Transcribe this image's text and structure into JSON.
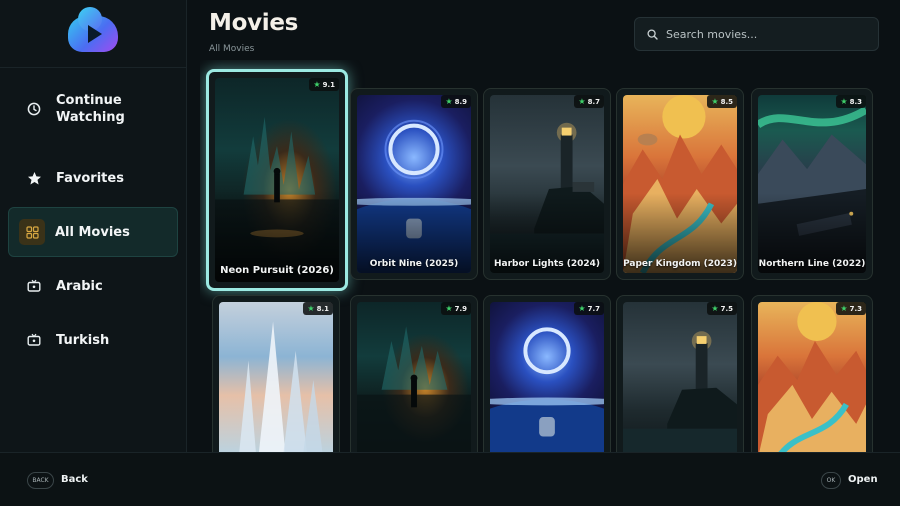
{
  "sidebar": {
    "items": [
      {
        "label": "Continue Watching",
        "icon": "clock-icon",
        "active": false
      },
      {
        "label": "Favorites",
        "icon": "star-icon",
        "active": false
      },
      {
        "label": "All Movies",
        "icon": "grid-icon",
        "active": true
      },
      {
        "label": "Arabic",
        "icon": "tv-icon",
        "active": false
      },
      {
        "label": "Turkish",
        "icon": "tv-icon",
        "active": false
      }
    ]
  },
  "header": {
    "title": "Movies",
    "breadcrumb": "All Movies",
    "search_placeholder": "Search movies..."
  },
  "movies": [
    {
      "title": "Neon Pursuit (2026)",
      "rating": "9.1",
      "art": "neon",
      "focused": true
    },
    {
      "title": "Orbit Nine (2025)",
      "rating": "8.9",
      "art": "orbit",
      "focused": false
    },
    {
      "title": "Harbor Lights (2024)",
      "rating": "8.7",
      "art": "harbor",
      "focused": false
    },
    {
      "title": "Paper Kingdom (2023)",
      "rating": "8.5",
      "art": "paper",
      "focused": false
    },
    {
      "title": "Northern Line (2022)",
      "rating": "8.3",
      "art": "north",
      "focused": false
    },
    {
      "title": "",
      "rating": "8.1",
      "art": "crystal",
      "focused": false
    },
    {
      "title": "",
      "rating": "7.9",
      "art": "neon",
      "focused": false
    },
    {
      "title": "",
      "rating": "7.7",
      "art": "orbit",
      "focused": false
    },
    {
      "title": "",
      "rating": "7.5",
      "art": "harbor",
      "focused": false
    },
    {
      "title": "",
      "rating": "7.3",
      "art": "paper",
      "focused": false
    }
  ],
  "footer": {
    "back_key": "BACK",
    "back_label": "Back",
    "ok_key": "OK",
    "ok_label": "Open"
  },
  "colors": {
    "accent_focus": "#9ce9e2",
    "rating_star": "#3fd06a",
    "background": "#0b1114"
  }
}
